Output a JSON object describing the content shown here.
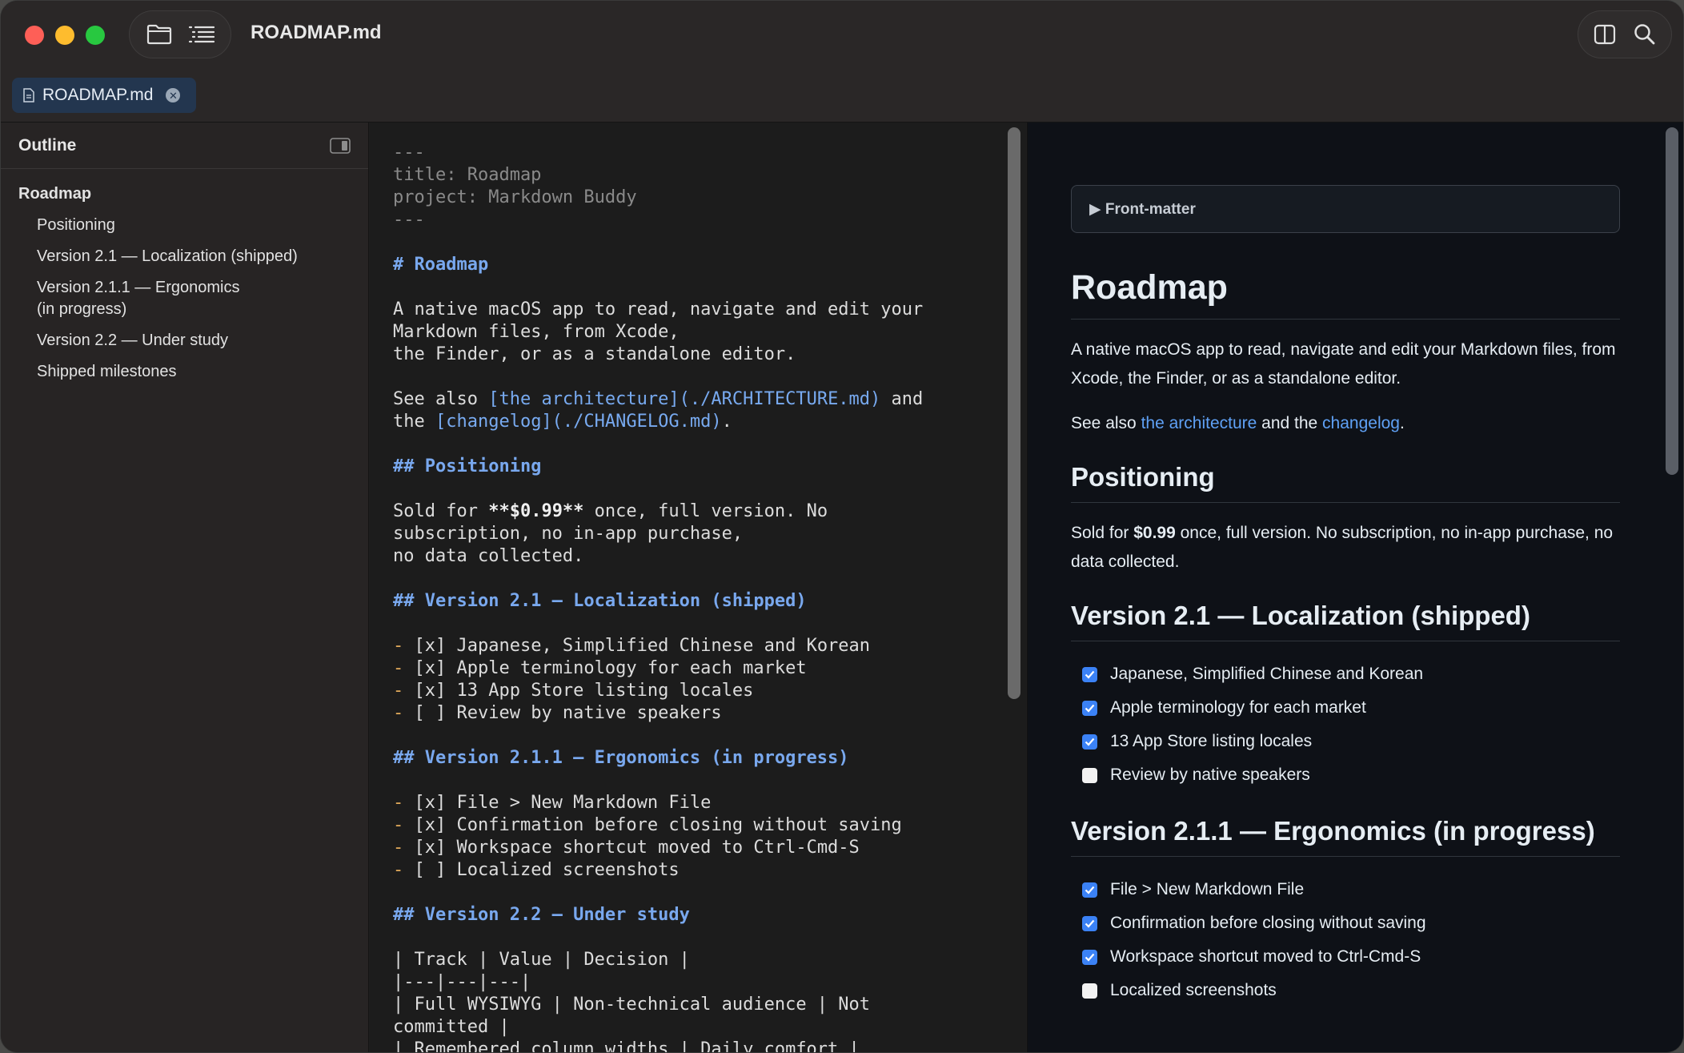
{
  "window": {
    "title": "ROADMAP.md"
  },
  "tabs": [
    {
      "label": "ROADMAP.md"
    }
  ],
  "sidebar": {
    "title": "Outline",
    "items": [
      {
        "label": "Roadmap",
        "level": 1
      },
      {
        "label": "Positioning",
        "level": 2
      },
      {
        "label": "Version 2.1 — Localization (shipped)",
        "level": 2
      },
      {
        "label": "Version 2.1.1 — Ergonomics (in progress)",
        "level": 2
      },
      {
        "label": "Version 2.2 — Under study",
        "level": 2
      },
      {
        "label": "Shipped milestones",
        "level": 2
      }
    ]
  },
  "editor": {
    "fm_open": "---",
    "fm_title": "title: Roadmap",
    "fm_project": "project: Markdown Buddy",
    "fm_close": "---",
    "h1": "# Roadmap",
    "intro_1": "A native macOS app to read, navigate and edit your",
    "intro_2": "Markdown files, from Xcode,",
    "intro_3": "the Finder, or as a standalone editor.",
    "see_also_prefix": "See also ",
    "link_architecture": "[the architecture](./ARCHITECTURE.md)",
    "see_also_and": " and",
    "see_also_the": "the ",
    "link_changelog": "[changelog](./CHANGELOG.md)",
    "see_also_end": ".",
    "h2_positioning": "## Positioning",
    "sold_prefix": "Sold for ",
    "sold_price": "**$0.99**",
    "sold_suffix": " once, full version. No",
    "sold_2": "subscription, no in-app purchase,",
    "sold_3": "no data collected.",
    "h2_v21": "## Version 2.1 — Localization (shipped)",
    "v21_items": [
      "[x] Japanese, Simplified Chinese and Korean",
      "[x] Apple terminology for each market",
      "[x] 13 App Store listing locales",
      "[ ] Review by native speakers"
    ],
    "h2_v211": "## Version 2.1.1 — Ergonomics (in progress)",
    "v211_items": [
      "[x] File > New Markdown File",
      "[x] Confirmation before closing without saving",
      "[x] Workspace shortcut moved to Ctrl-Cmd-S",
      "[ ] Localized screenshots"
    ],
    "h2_v22": "## Version 2.2 — Under study",
    "table_1": "| Track | Value | Decision |",
    "table_2": "|---|---|---|",
    "table_3": "| Full WYSIWYG | Non-technical audience | Not",
    "table_4": "committed |",
    "table_5": "| Remembered column widths | Daily comfort |",
    "bullet": "-"
  },
  "preview": {
    "frontmatter_label": "▶ Front-matter",
    "h1": "Roadmap",
    "intro": "A native macOS app to read, navigate and edit your Markdown files, from Xcode, the Finder, or as a standalone editor.",
    "see_also_prefix": "See also ",
    "link_architecture": "the architecture",
    "see_also_mid": " and the ",
    "link_changelog": "changelog",
    "see_also_end": ".",
    "h2_positioning": "Positioning",
    "sold_prefix": "Sold for ",
    "sold_price": "$0.99",
    "sold_suffix": " once, full version. No subscription, no in-app purchase, no data collected.",
    "h2_v21": "Version 2.1 — Localization (shipped)",
    "v21_tasks": [
      {
        "label": "Japanese, Simplified Chinese and Korean",
        "checked": true
      },
      {
        "label": "Apple terminology for each market",
        "checked": true
      },
      {
        "label": "13 App Store listing locales",
        "checked": true
      },
      {
        "label": "Review by native speakers",
        "checked": false
      }
    ],
    "h2_v211": "Version 2.1.1 — Ergonomics (in progress)",
    "v211_tasks": [
      {
        "label": "File > New Markdown File",
        "checked": true
      },
      {
        "label": "Confirmation before closing without saving",
        "checked": true
      },
      {
        "label": "Workspace shortcut moved to Ctrl-Cmd-S",
        "checked": true
      },
      {
        "label": "Localized screenshots",
        "checked": false
      }
    ]
  },
  "colors": {
    "accent": "#3b82f6",
    "link": "#5fa1f5",
    "heading_source": "#79a8ee",
    "bullet_source": "#e0a95a",
    "tab_bg": "#23364f"
  },
  "icons": {
    "folder": "folder-icon",
    "outline": "list-outline-icon",
    "split": "split-view-icon",
    "search": "search-icon",
    "file": "document-icon",
    "close": "close-icon",
    "sidebar_toggle": "sidebar-toggle-icon"
  }
}
